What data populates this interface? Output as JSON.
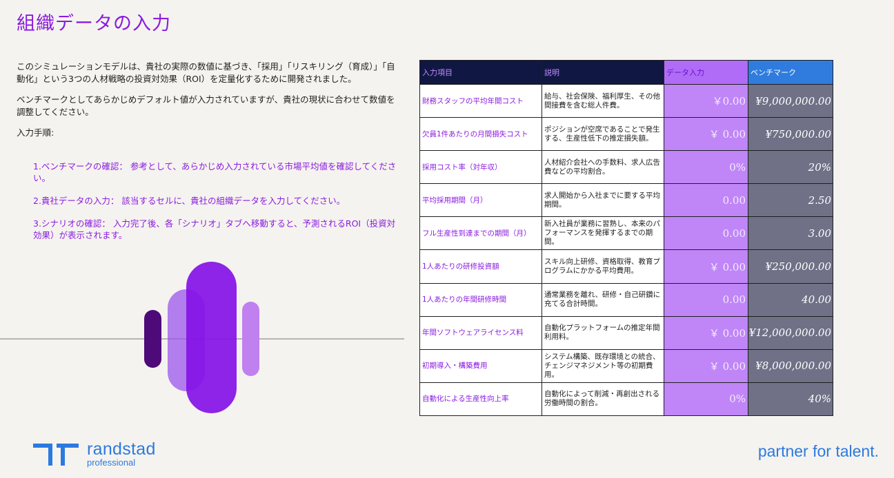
{
  "title": "組織データの入力",
  "intro": {
    "p1": "このシミュレーションモデルは、貴社の実際の数値に基づき、「採用」「リスキリング（育成）」「自動化」という3つの人材戦略の投資対効果（ROI）を定量化するために開発されました。",
    "p2": "ベンチマークとしてあらかじめデフォルト値が入力されていますが、貴社の現状に合わせて数値を調整してください。",
    "heading": "入力手順:"
  },
  "steps": [
    "1.ベンチマークの確認： 参考として、あらかじめ入力されている市場平均値を確認してください。",
    "2.貴社データの入力： 該当するセルに、貴社の組織データを入力してください。",
    "3.シナリオの確認： 入力完了後、各「シナリオ」タブへ移動すると、予測されるROI（投資対効果）が表示されます。"
  ],
  "table": {
    "headers": {
      "item": "入力項目",
      "desc": "説明",
      "input": "データ入力",
      "bench": "ベンチマーク"
    },
    "rows": [
      {
        "item": "財務スタッフの平均年間コスト",
        "desc": "給与、社会保険、福利厚生、その他間接費を含む総人件費。",
        "input": "￥0.00",
        "bench": "¥9,000,000.00"
      },
      {
        "item": "欠員1件あたりの月間損失コスト",
        "desc": "ポジションが空席であることで発生する、生産性低下の推定損失額。",
        "input": "￥ 0.00",
        "bench": "¥750,000.00"
      },
      {
        "item": "採用コスト率（対年収）",
        "desc": "人材紹介会社への手数料、求人広告費などの平均割合。",
        "input": "0%",
        "bench": "20%"
      },
      {
        "item": "平均採用期間（月）",
        "desc": "求人開始から入社までに要する平均期間。",
        "input": "0.00",
        "bench": "2.50"
      },
      {
        "item": "フル生産性到達までの期間（月）",
        "desc": "新入社員が業務に習熟し、本来のパフォーマンスを発揮するまでの期間。",
        "input": "0.00",
        "bench": "3.00"
      },
      {
        "item": "1人あたりの研修投資額",
        "desc": "スキル向上研修、資格取得、教育プログラムにかかる平均費用。",
        "input": "￥ 0.00",
        "bench": "¥250,000.00"
      },
      {
        "item": "1人あたりの年間研修時間",
        "desc": "通常業務を離れ、研修・自己研鑽に充てる合計時間。",
        "input": "0.00",
        "bench": "40.00"
      },
      {
        "item": "年間ソフトウェアライセンス料",
        "desc": "自動化プラットフォームの推定年間利用料。",
        "input": "￥ 0.00",
        "bench": "¥12,000,000.00"
      },
      {
        "item": "初期導入・構築費用",
        "desc": "システム構築、既存環境との統合、チェンジマネジメント等の初期費用。",
        "input": "￥ 0.00",
        "bench": "¥8,000,000.00"
      },
      {
        "item": "自動化による生産性向上率",
        "desc": "自動化によって削減・再創出される労働時間の割合。",
        "input": "0%",
        "bench": "40%"
      }
    ]
  },
  "footer": {
    "logo_name": "randstad",
    "logo_sub": "professional",
    "tagline": "partner for talent."
  },
  "colors": {
    "accent_purple": "#8a1be0",
    "brand_blue": "#2b7ae0",
    "header_navy": "#111743",
    "input_cell": "#c086f7",
    "benchmark_cell": "#707187"
  }
}
